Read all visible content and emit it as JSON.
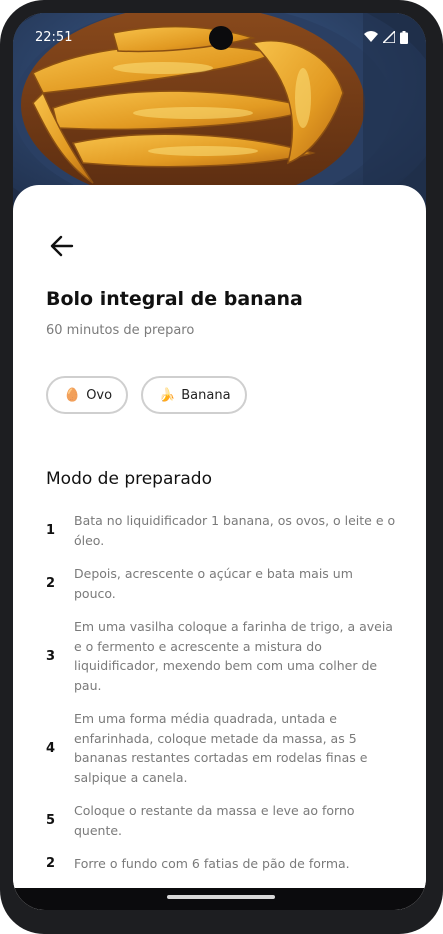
{
  "status_bar": {
    "time": "22:51"
  },
  "recipe": {
    "title": "Bolo integral de banana",
    "subtitle": "60 minutos de preparo"
  },
  "ingredients": [
    {
      "emoji": "🥚",
      "label": "Ovo"
    },
    {
      "emoji": "🍌",
      "label": "Banana"
    }
  ],
  "method": {
    "title": "Modo de preparado",
    "steps": [
      {
        "number": "1",
        "text": "Bata no liquidificador 1 banana, os ovos, o leite e o óleo."
      },
      {
        "number": "2",
        "text": "Depois, acrescente o açúcar e bata mais um pouco."
      },
      {
        "number": "3",
        "text": "Em uma vasilha coloque a farinha de trigo, a aveia e o fermento e acrescente a mistura do liquidificador, mexendo bem com uma colher de pau."
      },
      {
        "number": "4",
        "text": "Em uma forma média quadrada, untada e enfarinhada, coloque metade da massa, as 5 bananas restantes cortadas em rodelas finas e salpique a canela."
      },
      {
        "number": "5",
        "text": "Coloque o restante da massa e leve ao forno quente."
      },
      {
        "number": "2",
        "text": "Forre o fundo com 6 fatias de pão de forma."
      }
    ]
  },
  "colors": {
    "accent_chip_border": "#cfcfcf",
    "muted_text": "#7a7a7a"
  }
}
